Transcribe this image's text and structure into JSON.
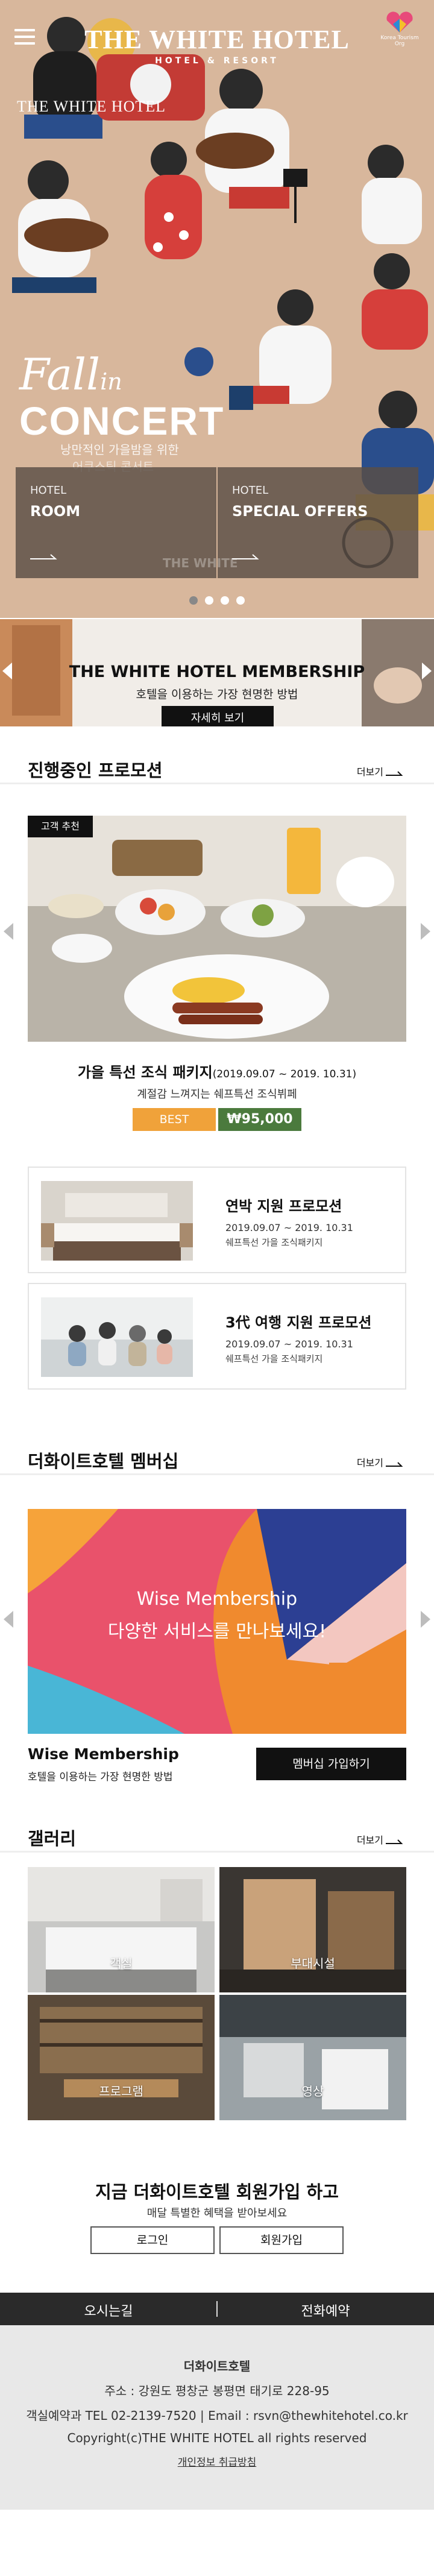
{
  "header": {
    "brand_name": "THE WHITE HOTEL",
    "brand_sub": "HOTEL & RESORT",
    "badge_text": "Korea Tourism Org",
    "menu_icon": "hamburger-menu-icon"
  },
  "hero": {
    "small_title": "THE WHITE HOTEL",
    "fall": "Fall",
    "in": "in",
    "concert": "CONCERT",
    "caption": "낭만적인 가을밤을 위한",
    "caption2": "어쿠스틱 콘서트",
    "watermark": "THE WHITE",
    "cards": [
      {
        "small": "HOTEL",
        "big": "ROOM"
      },
      {
        "small": "HOTEL",
        "big": "SPECIAL OFFERS"
      }
    ],
    "slides": 4,
    "active_slide": 1
  },
  "banner": {
    "title": "THE WHITE HOTEL MEMBERSHIP",
    "subtitle": "호텔을 이용하는 가장 현명한 방법",
    "button": "자세히 보기"
  },
  "promotion": {
    "heading": "진행중인 프로모션",
    "more": "더보기",
    "tag": "고객 추천",
    "main_title": "가을 특선 조식 패키지",
    "main_date": "(2019.09.07 ~ 2019. 10.31)",
    "main_desc": "계절감 느껴지는 쉐프특선 조식뷔페",
    "best": "BEST",
    "price": "₩95,000",
    "items": [
      {
        "title": "연박 지원 프로모션",
        "date": "2019.09.07 ~ 2019. 10.31",
        "desc": "쉐프특선 가을 조식패키지"
      },
      {
        "title": "3代 여행 지원 프로모션",
        "date": "2019.09.07 ~ 2019. 10.31",
        "desc": "쉐프특선 가을 조식패키지"
      }
    ]
  },
  "membership": {
    "heading": "더화이트호텔 멤버십",
    "more": "더보기",
    "image_title": "Wise Membership",
    "image_sub": "다양한 서비스를 만나보세요!",
    "name": "Wise Membership",
    "desc": "호텔을 이용하는 가장 현명한 방법",
    "button": "멤버십 가입하기"
  },
  "gallery": {
    "heading": "갤러리",
    "more": "더보기",
    "items": [
      {
        "label": "객실"
      },
      {
        "label": "부대시설"
      },
      {
        "label": "프로그램"
      },
      {
        "label": "영상"
      }
    ]
  },
  "join": {
    "title": "지금 더화이트호텔 회원가입 하고",
    "subtitle": "매달 특별한 혜택을 받아보세요",
    "login": "로그인",
    "signup": "회원가입"
  },
  "footer": {
    "directions": "오시는길",
    "phone_reservation": "전화예약",
    "name": "더화이트호텔",
    "address": "주소 : 강원도 평창군 봉평면 태기로 228-95",
    "contact": "객실예약과 TEL 02-2139-7520 | Email : rsvn@thewhitehotel.co.kr",
    "copyright": "Copyright(c)THE WHITE HOTEL all rights reserved",
    "privacy": "개인정보 취급방침"
  },
  "colors": {
    "hero_bg": "#d6b59a",
    "best": "#f0a23a",
    "price": "#4b7a3d",
    "footer_bar": "#2a2a2a",
    "footer_bg": "#e8e8e8"
  }
}
